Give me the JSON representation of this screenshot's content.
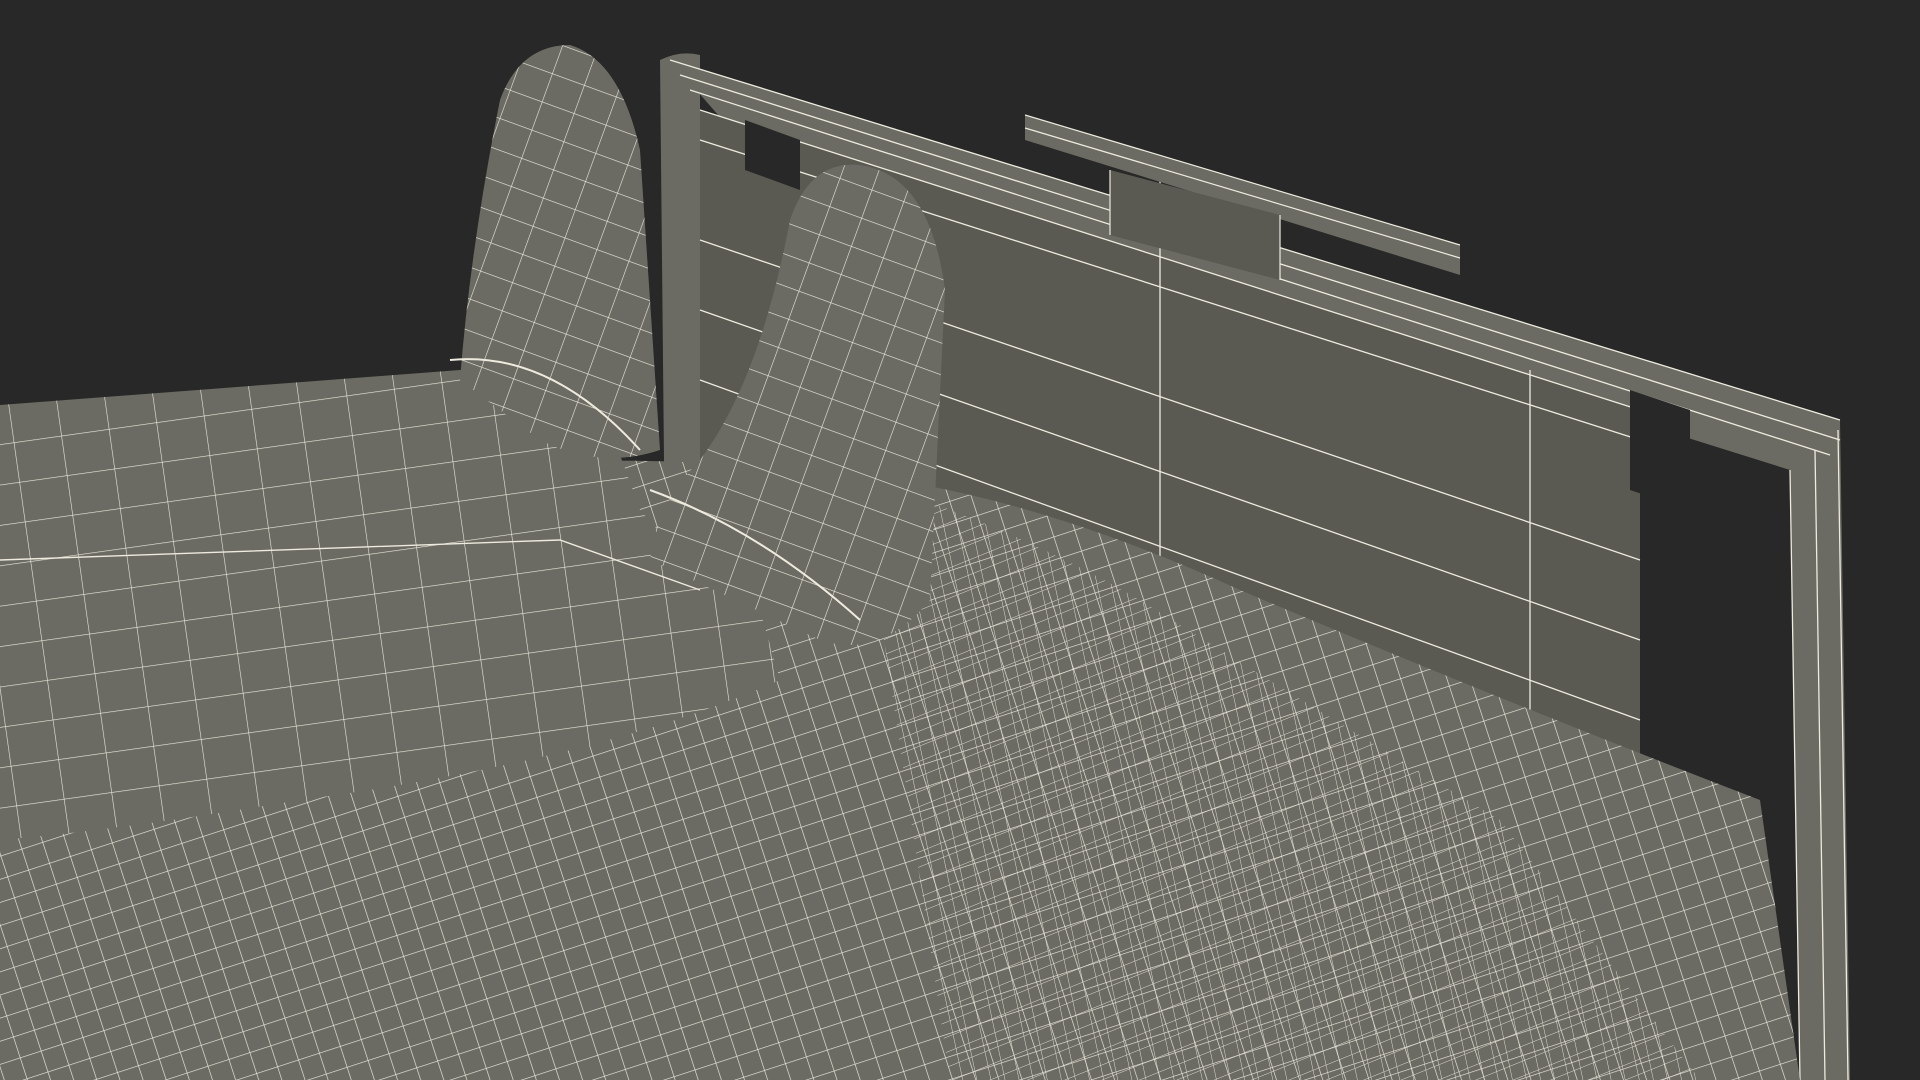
{
  "scene": {
    "background_color": "#272827",
    "surface_color": "#6b6b63",
    "surface_shadow_color": "#5a5a53",
    "wire_color": "#eeeade",
    "objects": [
      {
        "name": "hospital-bed-footboard",
        "icon": "footboard-icon"
      },
      {
        "name": "clipboard-holder-rail",
        "icon": "rail-icon"
      },
      {
        "name": "bed-sheet",
        "icon": "sheet-mesh-icon"
      },
      {
        "name": "left-foot-slipper",
        "icon": "slipper-icon"
      },
      {
        "name": "right-foot-slipper",
        "icon": "slipper-icon"
      },
      {
        "name": "legs",
        "icon": "legs-icon"
      }
    ]
  }
}
